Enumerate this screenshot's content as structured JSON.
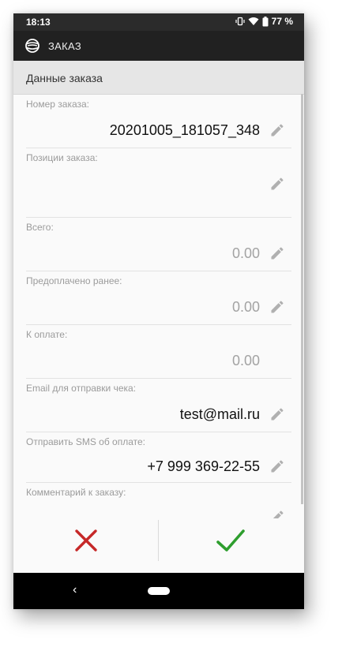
{
  "status_bar": {
    "time": "18:13",
    "battery": "77 %",
    "icons": [
      "vibrate-icon",
      "wifi-icon",
      "battery-icon"
    ]
  },
  "app_bar": {
    "title": "ЗАКАЗ",
    "logo_icon": "globe-logo-icon"
  },
  "section": {
    "title": "Данные заказа"
  },
  "fields": {
    "order_number": {
      "label": "Номер заказа:",
      "value": "20201005_181057_348"
    },
    "order_items": {
      "label": "Позиции заказа:",
      "value": ""
    },
    "total": {
      "label": "Всего:",
      "value": "0.00"
    },
    "prepaid": {
      "label": "Предоплачено ранее:",
      "value": "0.00"
    },
    "to_pay": {
      "label": "К оплате:",
      "value": "0.00"
    },
    "email": {
      "label": "Email для отправки чека:",
      "value": "test@mail.ru"
    },
    "sms": {
      "label": "Отправить SMS об оплате:",
      "value": "+7 999 369-22-55"
    },
    "comment": {
      "label": "Комментарий к заказу:",
      "value": ""
    }
  },
  "actions": {
    "cancel_icon": "close-icon",
    "confirm_icon": "check-icon"
  },
  "colors": {
    "cancel": "#c62828",
    "confirm": "#2e9e2e",
    "appbar": "#212121",
    "statusbar": "#2b2b2b"
  },
  "nav_bar": {
    "back_glyph": "‹"
  }
}
